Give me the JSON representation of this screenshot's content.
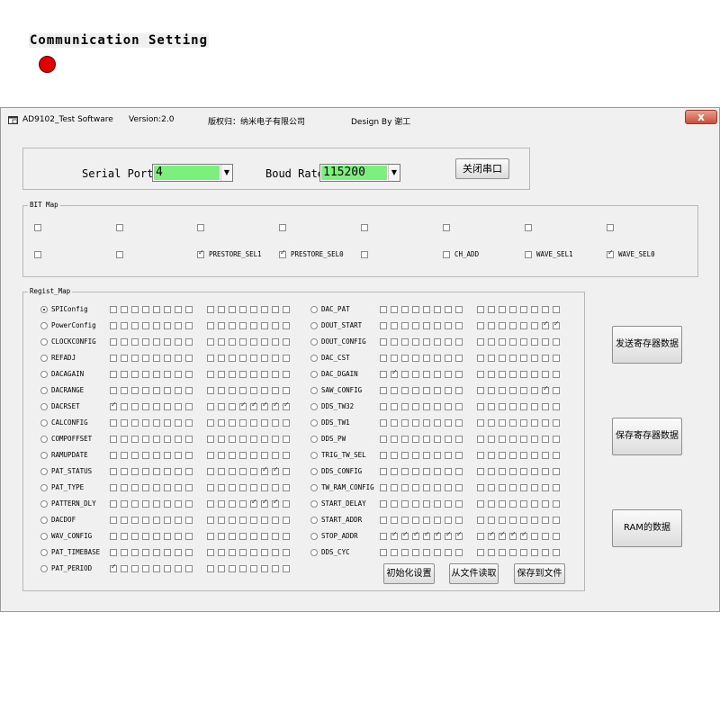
{
  "titlebar": {
    "app_name": "AD9102_Test Software",
    "version": "Version:2.0",
    "copyright": "版权归：纳米电子有限公司",
    "design": "Design By 谢工",
    "close_glyph": "x"
  },
  "comm": {
    "title": "Communication Setting",
    "status_color": "#e00000",
    "serial_port_label": "Serial Port",
    "serial_port_value": "4",
    "baud_rate_label": "Boud Rate",
    "baud_rate_value": "115200",
    "close_port_button": "关闭串口"
  },
  "bitmap": {
    "title": "BIT Map",
    "row1": [
      {
        "label": "",
        "checked": false
      },
      {
        "label": "",
        "checked": false
      },
      {
        "label": "",
        "checked": false
      },
      {
        "label": "",
        "checked": false
      },
      {
        "label": "",
        "checked": false
      },
      {
        "label": "",
        "checked": false
      },
      {
        "label": "",
        "checked": false
      },
      {
        "label": "",
        "checked": false
      }
    ],
    "row2": [
      {
        "label": "",
        "checked": false
      },
      {
        "label": "",
        "checked": false
      },
      {
        "label": "PRESTORE_SEL1",
        "checked": true
      },
      {
        "label": "PRESTORE_SEL0",
        "checked": true
      },
      {
        "label": "",
        "checked": false
      },
      {
        "label": "CH_ADD",
        "checked": false
      },
      {
        "label": "WAVE_SEL1",
        "checked": false
      },
      {
        "label": "WAVE_SEL0",
        "checked": true
      }
    ]
  },
  "regmap": {
    "title": "Regist_Map",
    "left": [
      {
        "name": "SPIConfig",
        "selected": true,
        "bits": "0000000000000000"
      },
      {
        "name": "PowerConfig",
        "selected": false,
        "bits": "0000000000000000"
      },
      {
        "name": "CLOCKCONFIG",
        "selected": false,
        "bits": "0000000000000000"
      },
      {
        "name": "REFADJ",
        "selected": false,
        "bits": "0000000000000000"
      },
      {
        "name": "DACAGAIN",
        "selected": false,
        "bits": "0000000000000000"
      },
      {
        "name": "DACRANGE",
        "selected": false,
        "bits": "0000000000000000"
      },
      {
        "name": "DACRSET",
        "selected": false,
        "bits": "1000000000011111"
      },
      {
        "name": "CALCONFIG",
        "selected": false,
        "bits": "0000000000000000"
      },
      {
        "name": "COMPOFFSET",
        "selected": false,
        "bits": "0000000000000000"
      },
      {
        "name": "RAMUPDATE",
        "selected": false,
        "bits": "0000000000000000"
      },
      {
        "name": "PAT_STATUS",
        "selected": false,
        "bits": "0000000000000110"
      },
      {
        "name": "PAT_TYPE",
        "selected": false,
        "bits": "0000000000000000"
      },
      {
        "name": "PATTERN_DLY",
        "selected": false,
        "bits": "0000000000001110"
      },
      {
        "name": "DACDOF",
        "selected": false,
        "bits": "0000000000000000"
      },
      {
        "name": "WAV_CONFIG",
        "selected": false,
        "bits": "0000000000000000"
      },
      {
        "name": "PAT_TIMEBASE",
        "selected": false,
        "bits": "0000000000000000"
      },
      {
        "name": "PAT_PERIOD",
        "selected": false,
        "bits": "1000000000000000"
      }
    ],
    "right": [
      {
        "name": "DAC_PAT",
        "selected": false,
        "bits": "0000000000000000"
      },
      {
        "name": "DOUT_START",
        "selected": false,
        "bits": "0000000000000011"
      },
      {
        "name": "DOUT_CONFIG",
        "selected": false,
        "bits": "0000000000000000"
      },
      {
        "name": "DAC_CST",
        "selected": false,
        "bits": "0000000000000000"
      },
      {
        "name": "DAC_DGAIN",
        "selected": false,
        "bits": "0100000000000000"
      },
      {
        "name": "SAW_CONFIG",
        "selected": false,
        "bits": "0000000000000010"
      },
      {
        "name": "DDS_TW32",
        "selected": false,
        "bits": "0000000000000000"
      },
      {
        "name": "DDS_TW1",
        "selected": false,
        "bits": "0000000000000000"
      },
      {
        "name": "DDS_PW",
        "selected": false,
        "bits": "0000000000000000"
      },
      {
        "name": "TRIG_TW_SEL",
        "selected": false,
        "bits": "0000000000000000"
      },
      {
        "name": "DDS_CONFIG",
        "selected": false,
        "bits": "0000000000000000"
      },
      {
        "name": "TW_RAM_CONFIG",
        "selected": false,
        "bits": "0000000000000000"
      },
      {
        "name": "START_DELAY",
        "selected": false,
        "bits": "0000000000000000"
      },
      {
        "name": "START_ADDR",
        "selected": false,
        "bits": "0000000000000000"
      },
      {
        "name": "STOP_ADDR",
        "selected": false,
        "bits": "0111111101111000"
      },
      {
        "name": "DDS_CYC",
        "selected": false,
        "bits": "0000000000000000"
      }
    ],
    "buttons": {
      "init": "初始化设置",
      "read_file": "从文件读取",
      "save_file": "保存到文件"
    }
  },
  "side_buttons": {
    "send": "发送寄存器数据",
    "save": "保存寄存器数据",
    "ram": "RAM的数据"
  }
}
